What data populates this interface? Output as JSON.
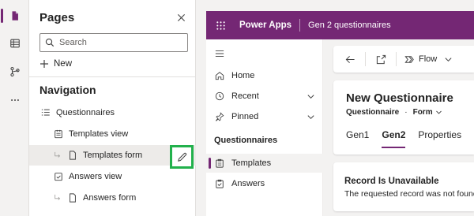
{
  "rail": {
    "items": [
      {
        "icon": "page-icon"
      },
      {
        "icon": "table-icon"
      },
      {
        "icon": "flow-icon"
      },
      {
        "icon": "more-icon"
      }
    ],
    "accent": "#742774"
  },
  "pages_panel": {
    "title": "Pages",
    "search_placeholder": "Search",
    "new_label": "New",
    "navigation_heading": "Navigation",
    "tree": [
      {
        "label": "Questionnaires",
        "icon": "list-icon"
      },
      {
        "label": "Templates view",
        "icon": "view-icon"
      },
      {
        "label": "Templates form",
        "icon": "form-icon",
        "selected": true
      },
      {
        "label": "Answers view",
        "icon": "view-check-icon"
      },
      {
        "label": "Answers form",
        "icon": "form-icon"
      }
    ]
  },
  "app_header": {
    "brand": "Power Apps",
    "app_name": "Gen 2 questionnaires",
    "color": "#742774"
  },
  "sitemap": {
    "items": [
      {
        "label": "Home",
        "icon": "home-icon"
      },
      {
        "label": "Recent",
        "icon": "clock-icon"
      },
      {
        "label": "Pinned",
        "icon": "pin-icon"
      }
    ],
    "group": "Questionnaires",
    "entities": [
      {
        "label": "Templates",
        "icon": "clipboard-icon",
        "active": true
      },
      {
        "label": "Answers",
        "icon": "clipboard-check-icon"
      }
    ]
  },
  "command_bar": {
    "flow_label": "Flow"
  },
  "form": {
    "title": "New Questionnaire",
    "entity": "Questionnaire",
    "form_selector": "Form",
    "tabs": [
      "Gen1",
      "Gen2",
      "Properties"
    ],
    "active_tab": "Gen2"
  },
  "notice": {
    "title": "Record Is Unavailable",
    "body": "The requested record was not found"
  }
}
